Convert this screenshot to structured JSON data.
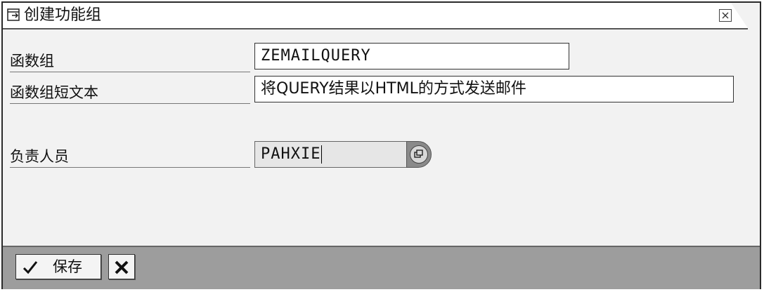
{
  "dialog": {
    "title": "创建功能组",
    "icons": {
      "title": "dialog-window-icon",
      "close": "close-icon"
    }
  },
  "form": {
    "function_group": {
      "label": "函数组",
      "value": "ZEMAILQUERY"
    },
    "short_text": {
      "label": "函数组短文本",
      "value": "将QUERY结果以HTML的方式发送邮件"
    },
    "person_responsible": {
      "label": "负责人员",
      "value": "PAHXIE",
      "help_icon": "value-help-icon"
    }
  },
  "footer": {
    "save_label": "保存",
    "save_icon": "checkmark-icon",
    "cancel_icon": "cancel-x-icon"
  }
}
